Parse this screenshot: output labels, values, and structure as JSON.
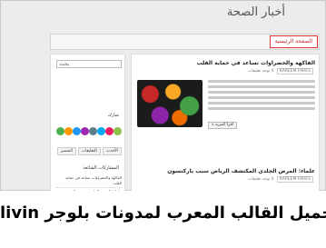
{
  "site": {
    "title": "أخبار الصحة"
  },
  "nav": {
    "home_label": "الصفحة الرئيسية"
  },
  "sidebar": {
    "search": {
      "button_label": "بحث",
      "placeholder": ""
    },
    "share_label": "شارك",
    "share_colors": [
      "#4caf50",
      "#ff9800",
      "#2196f3",
      "#9c27b0",
      "#607d8b",
      "#03a9f4",
      "#e91e63",
      "#8bc34a"
    ],
    "tabs": [
      "الأحدث",
      "التعليقات",
      "المتميز"
    ],
    "recent_heading": "المشاركات الشائعة",
    "recent_items": [
      "الفاكهة والخضراوات تساعد في حماية القلب",
      "علماء: المرض الجلدي يصيب ملايين",
      "دراسة جديدة عن الصحة العامة",
      "فوائد الرياضة اليومية للجسم",
      "الغذاء الصحي وطول العمر"
    ]
  },
  "posts": [
    {
      "title": "الفاكهة والخضراوات تساعد في حماية القلب",
      "meta_author": "KAREEM FARES",
      "meta_comments": "لا توجد تعليقات",
      "read_more": "اقرأ المزيد »"
    },
    {
      "title": "علماء: المرض الجلدي المكتشف الرياض سبب باركنسون",
      "meta_author": "KAREEM FARES",
      "meta_comments": "لا توجد تعليقات"
    }
  ],
  "banner": {
    "text": "livin تحميل القالب المعرب لمدونات بلوجر"
  }
}
